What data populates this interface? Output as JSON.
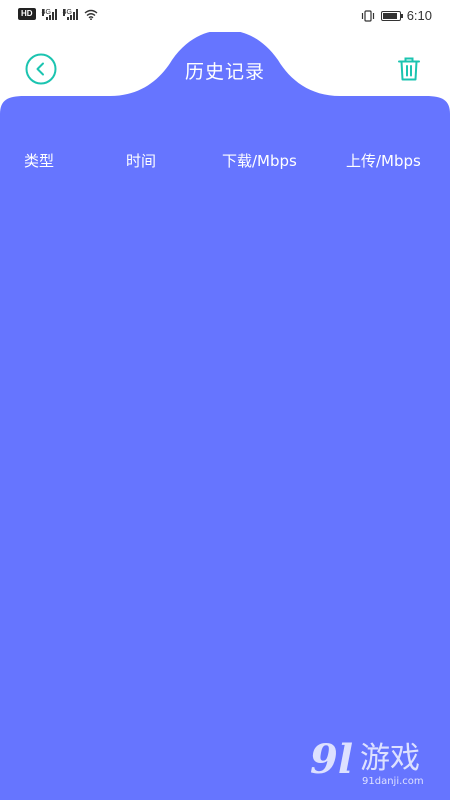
{
  "status_bar": {
    "hd_label": "HD",
    "sim1_label": "4G",
    "sim2_label": "4G",
    "time": "6:10",
    "battery_level": 0.85
  },
  "header": {
    "title": "历史记录",
    "back_icon": "chevron-left-circle-icon",
    "delete_icon": "trash-icon"
  },
  "table": {
    "columns": [
      "类型",
      "时间",
      "下载/Mbps",
      "上传/Mbps"
    ],
    "rows": []
  },
  "watermark": {
    "logo": "9l",
    "name": "游戏",
    "url": "91danji.com"
  },
  "colors": {
    "primary": "#6675FF",
    "accent": "#1BC4B0",
    "background": "#FFFFFF"
  }
}
